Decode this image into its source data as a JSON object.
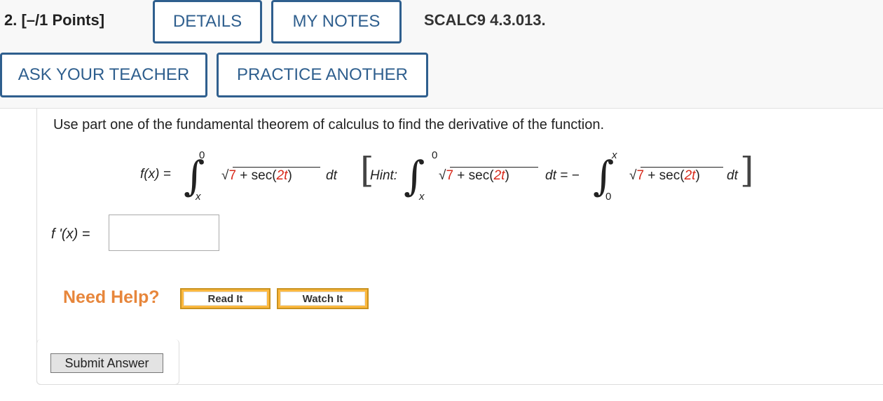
{
  "header": {
    "question_label": "2. [–/1 Points]",
    "details_label": "DETAILS",
    "mynotes_label": "MY NOTES",
    "question_id": "SCALC9 4.3.013.",
    "ask_teacher_label": "ASK YOUR TEACHER",
    "practice_another_label": "PRACTICE ANOTHER"
  },
  "problem": {
    "prompt": "Use part one of the fundamental theorem of calculus to find the derivative of the function.",
    "function_lhs": "f(x) =",
    "integral_upper": "0",
    "integral_lower": "x",
    "integrand_const": "7",
    "integrand_plus": " + sec(",
    "integrand_coef": "2t",
    "integrand_close": ")",
    "dt": "dt",
    "hint_label": "Hint:",
    "hint_eq": "dt = −",
    "hint_upper2": "x",
    "hint_lower2": "0"
  },
  "answer": {
    "label": "f '(x) =",
    "value": ""
  },
  "help": {
    "need_help_label": "Need Help?",
    "read_it_label": "Read It",
    "watch_it_label": "Watch It"
  },
  "submit_label": "Submit Answer",
  "colors": {
    "accent": "#2f5f8e",
    "help_orange": "#e7863b",
    "highlight_red": "#d8291b"
  }
}
